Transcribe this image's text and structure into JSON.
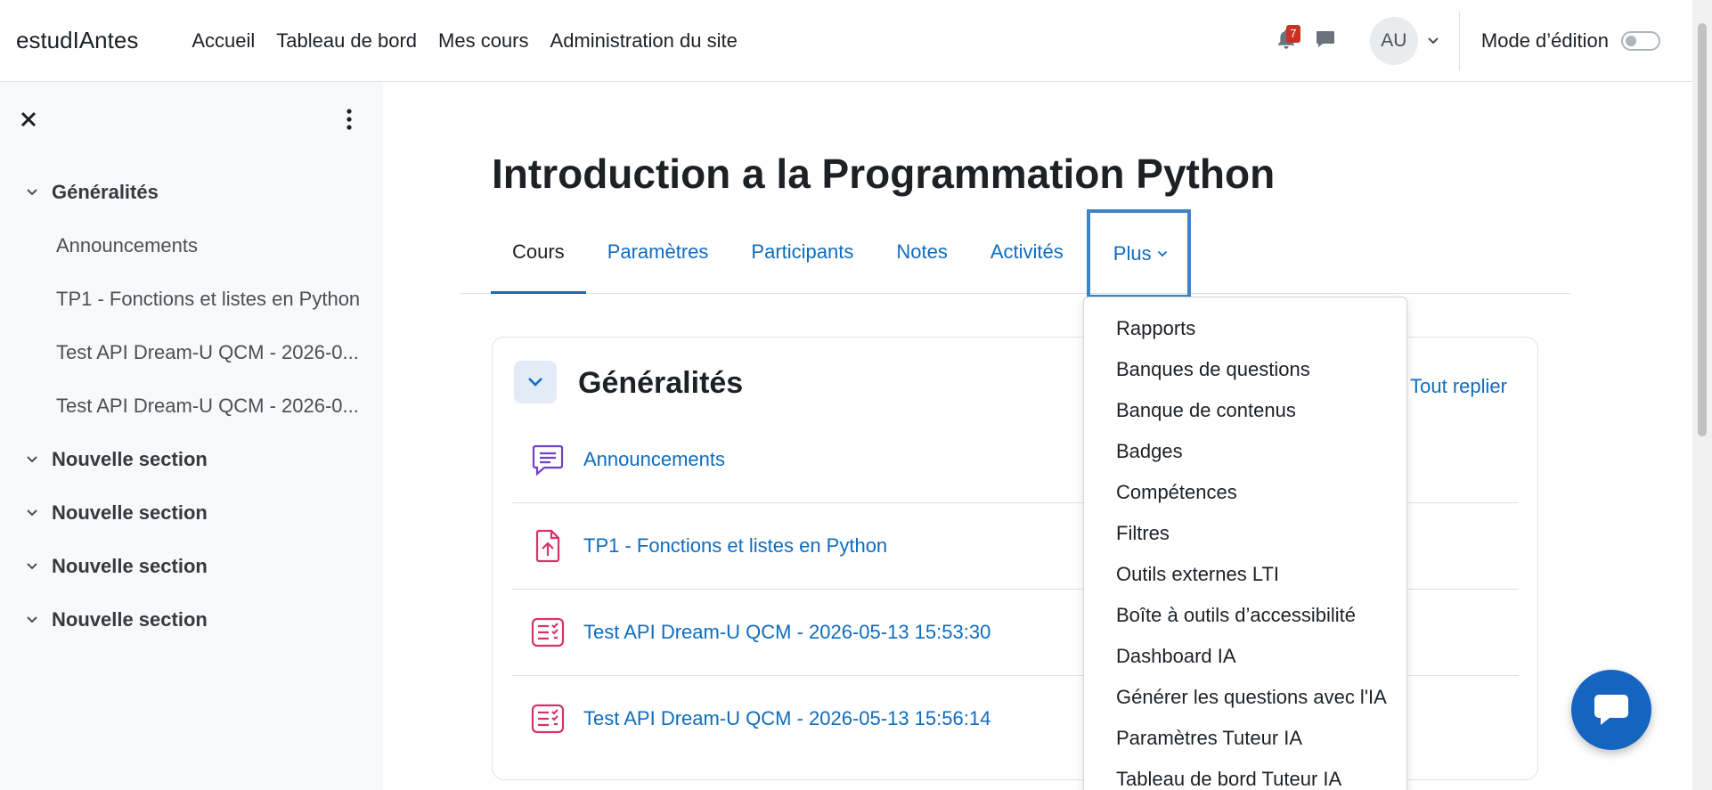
{
  "navbar": {
    "brand": "estudIAntes",
    "links": [
      "Accueil",
      "Tableau de bord",
      "Mes cours",
      "Administration du site"
    ],
    "notification_count": "7",
    "avatar_initials": "AU",
    "edit_mode_label": "Mode d’édition",
    "icons": [
      "bell-icon",
      "chat-bubble-icon",
      "chevron-down-icon"
    ]
  },
  "drawer": {
    "sections": [
      {
        "title": "Généralités",
        "items": [
          "Announcements",
          "TP1 - Fonctions et listes en Python",
          "Test API Dream-U QCM - 2026-0...",
          "Test API Dream-U QCM - 2026-0..."
        ]
      },
      {
        "title": "Nouvelle section",
        "items": []
      },
      {
        "title": "Nouvelle section",
        "items": []
      },
      {
        "title": "Nouvelle section",
        "items": []
      },
      {
        "title": "Nouvelle section",
        "items": []
      }
    ]
  },
  "course": {
    "title": "Introduction a la Programmation Python",
    "tabs": [
      "Cours",
      "Paramètres",
      "Participants",
      "Notes",
      "Activités",
      "Plus"
    ],
    "active_tab": "Cours"
  },
  "section": {
    "title": "Généralités",
    "collapse_all": "Tout replier",
    "activities": [
      {
        "name": "Announcements",
        "icon": "forum-icon",
        "icon_color": "#6f42c1"
      },
      {
        "name": "TP1 - Fonctions et listes en Python",
        "icon": "assignment-upload-icon",
        "icon_color": "#d6336c"
      },
      {
        "name": "Test API Dream-U QCM - 2026-05-13 15:53:30",
        "icon": "quiz-icon",
        "icon_color": "#d6336c"
      },
      {
        "name": "Test API Dream-U QCM - 2026-05-13 15:56:14",
        "icon": "quiz-icon",
        "icon_color": "#d6336c"
      }
    ]
  },
  "more_menu": {
    "items": [
      "Rapports",
      "Banques de questions",
      "Banque de contenus",
      "Badges",
      "Compétences",
      "Filtres",
      "Outils externes LTI",
      "Boîte à outils d’accessibilité",
      "Dashboard IA",
      "Générer les questions avec l'IA",
      "Paramètres Tuteur IA",
      "Tableau de bord Tuteur IA"
    ]
  },
  "colors": {
    "link": "#0f6cbf",
    "drawer_bg": "#f8f9fa",
    "badge": "#ca3120",
    "focus_outline": "#3d85c6",
    "chat_fab": "#1565c0"
  }
}
